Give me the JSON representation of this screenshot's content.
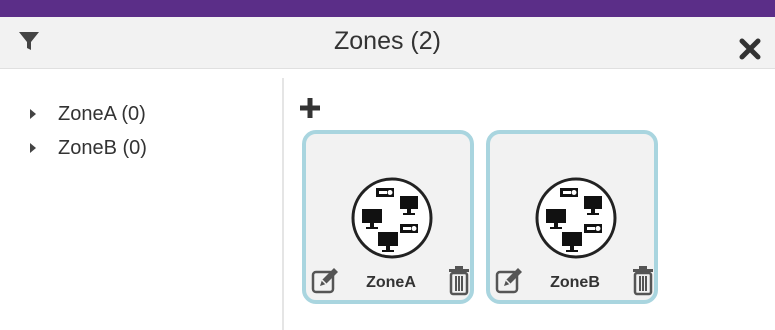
{
  "header": {
    "title": "Zones (2)",
    "filter_icon": "filter-icon",
    "close_icon": "close-icon"
  },
  "tree": {
    "items": [
      {
        "label": "ZoneA (0)",
        "icon": "caret-right-icon"
      },
      {
        "label": "ZoneB (0)",
        "icon": "caret-right-icon"
      }
    ]
  },
  "toolbar": {
    "add_icon": "plus-icon"
  },
  "cards": [
    {
      "name": "ZoneA",
      "icon": "zone-devices-icon",
      "edit_icon": "edit-icon",
      "delete_icon": "trash-icon"
    },
    {
      "name": "ZoneB",
      "icon": "zone-devices-icon",
      "edit_icon": "edit-icon",
      "delete_icon": "trash-icon"
    }
  ],
  "colors": {
    "accent_bar": "#5b2e88",
    "card_border": "#a9d5df",
    "card_bg": "#f2f2f2",
    "header_bg": "#f2f2f2"
  }
}
